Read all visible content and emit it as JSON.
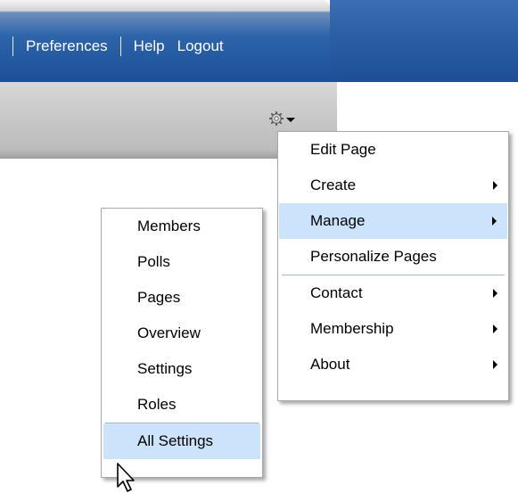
{
  "nav": {
    "preferences": "Preferences",
    "help": "Help",
    "logout": "Logout"
  },
  "page_actions": {
    "gear_icon": "gear-icon",
    "dropdown_icon": "caret-down-icon"
  },
  "main_menu": {
    "items": [
      {
        "label": "Edit Page",
        "submenu": false
      },
      {
        "label": "Create",
        "submenu": true
      },
      {
        "label": "Manage",
        "submenu": true,
        "highlighted": true
      },
      {
        "label": "Personalize Pages",
        "submenu": false
      },
      {
        "label": "Contact",
        "submenu": true
      },
      {
        "label": "Membership",
        "submenu": true
      },
      {
        "label": "About",
        "submenu": true
      }
    ]
  },
  "manage_submenu": {
    "items": [
      {
        "label": "Members"
      },
      {
        "label": "Polls"
      },
      {
        "label": "Pages"
      },
      {
        "label": "Overview"
      },
      {
        "label": "Settings"
      },
      {
        "label": "Roles"
      },
      {
        "label": "All Settings",
        "highlighted": true
      }
    ]
  },
  "colors": {
    "header_blue": "#1d4f97",
    "menu_highlight": "#cce4fb",
    "band_gray": "#c4c4c4"
  }
}
